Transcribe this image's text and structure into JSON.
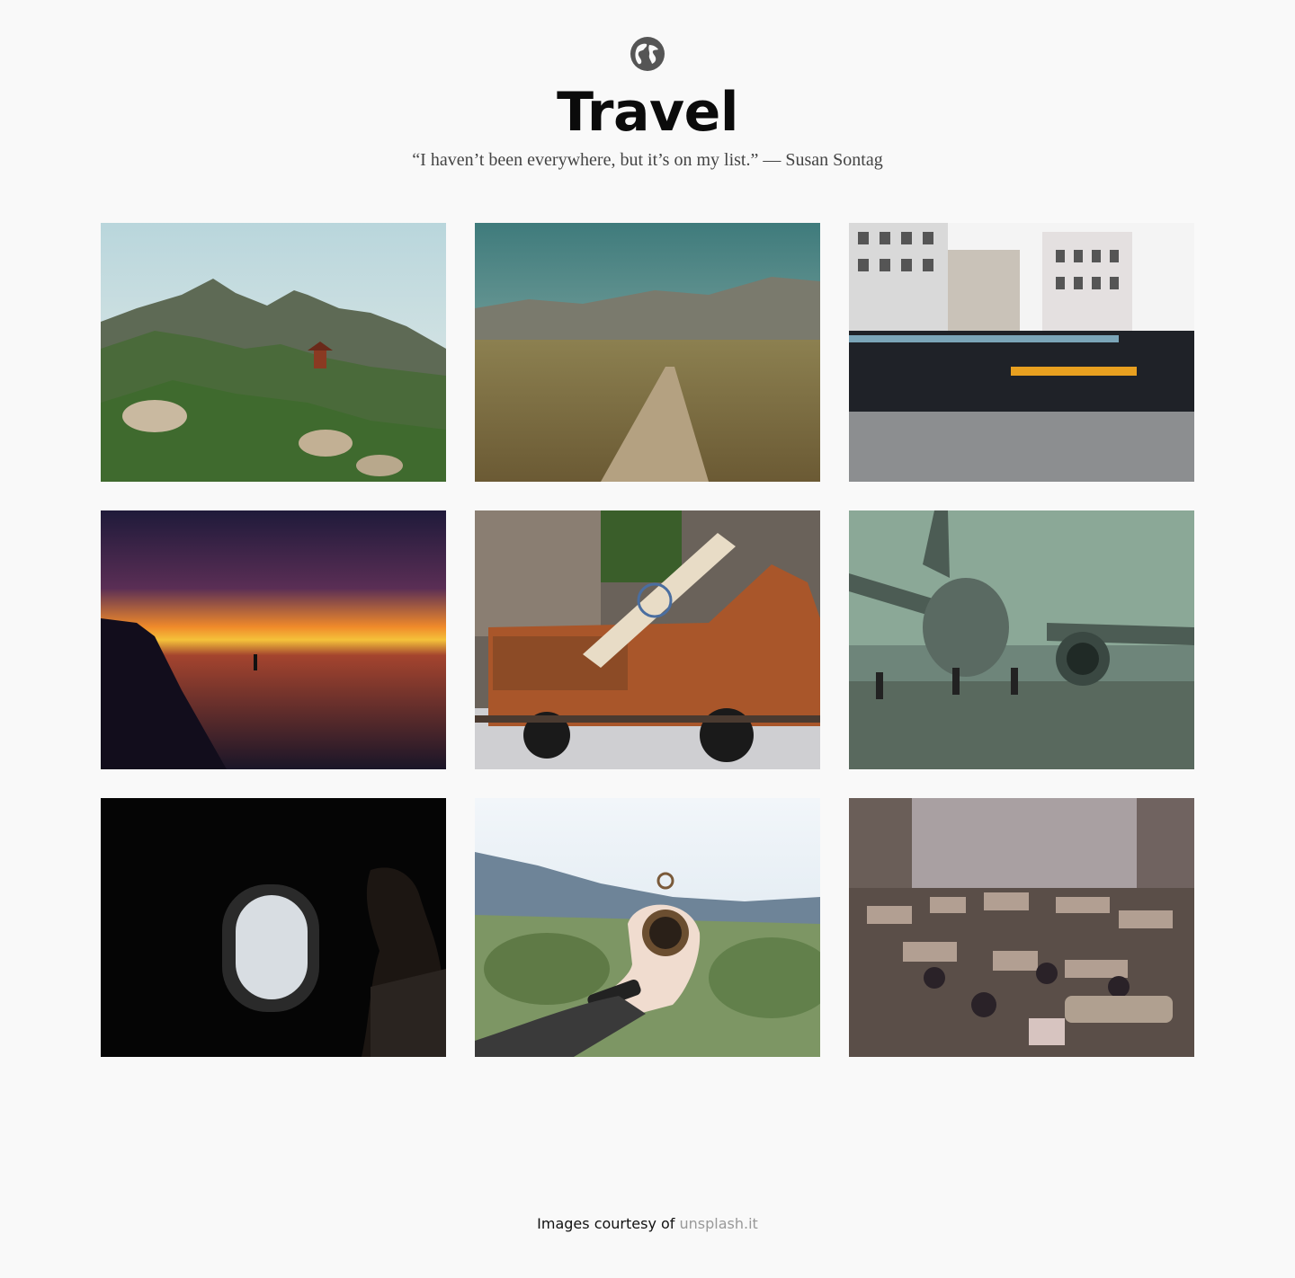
{
  "header": {
    "icon": "globe-icon",
    "title": "Travel",
    "quote": "“I haven’t been everywhere, but it’s on my list.” — Susan Sontag"
  },
  "gallery": {
    "photos": [
      {
        "subject": "mountain pagoda"
      },
      {
        "subject": "desert road"
      },
      {
        "subject": "city bus motion blur"
      },
      {
        "subject": "beach sunset"
      },
      {
        "subject": "rusty truck with surfboard"
      },
      {
        "subject": "airplane on runway"
      },
      {
        "subject": "airplane window"
      },
      {
        "subject": "hand holding compass"
      },
      {
        "subject": "crowded street rickshaws"
      }
    ]
  },
  "footer": {
    "prefix": "Images courtesy of ",
    "link_label": "unsplash.it"
  },
  "colors": {
    "background": "#f9f9f9",
    "link": "#999999"
  }
}
